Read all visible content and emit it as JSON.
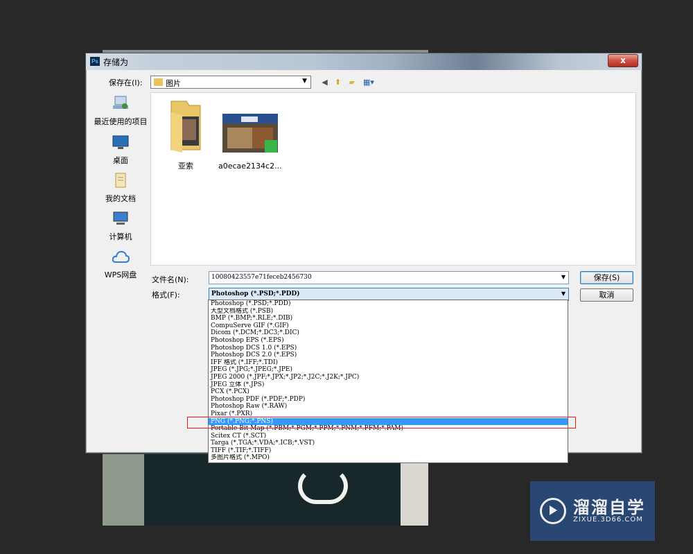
{
  "dialog": {
    "title": "存储为",
    "app_icon_label": "Ps",
    "close_label": "x",
    "look_in_label": "保存在(I):",
    "look_in_value": "图片",
    "places": [
      {
        "label": "最近使用的项目",
        "icon": "recent-items-icon"
      },
      {
        "label": "桌面",
        "icon": "desktop-icon"
      },
      {
        "label": "我的文档",
        "icon": "documents-icon"
      },
      {
        "label": "计算机",
        "icon": "computer-icon"
      },
      {
        "label": "WPS网盘",
        "icon": "cloud-icon"
      }
    ],
    "files": [
      {
        "name": "亚索",
        "type": "folder"
      },
      {
        "name": "a0ecae2134c2...",
        "type": "png-image"
      }
    ],
    "filename_label": "文件名(N):",
    "filename_value": "10080423557e71feceb2456730",
    "format_label": "格式(F):",
    "format_value": "Photoshop (*.PSD;*.PDD)",
    "save_button": "保存(S)",
    "cancel_button": "取消"
  },
  "format_options": [
    "Photoshop (*.PSD;*.PDD)",
    "大型文档格式 (*.PSB)",
    "BMP (*.BMP;*.RLE;*.DIB)",
    "CompuServe GIF (*.GIF)",
    "Dicom (*.DCM;*.DC3;*.DIC)",
    "Photoshop EPS (*.EPS)",
    "Photoshop DCS 1.0 (*.EPS)",
    "Photoshop DCS 2.0 (*.EPS)",
    "IFF 格式 (*.IFF;*.TDI)",
    "JPEG (*.JPG;*.JPEG;*.JPE)",
    "JPEG 2000 (*.JPF;*.JPX;*.JP2;*.J2C;*.J2K;*.JPC)",
    "JPEG 立体 (*.JPS)",
    "PCX (*.PCX)",
    "Photoshop PDF (*.PDF;*.PDP)",
    "Photoshop Raw (*.RAW)",
    "Pixar (*.PXR)",
    "PNG (*.PNG;*.PNS)",
    "Portable Bit Map (*.PBM;*.PGM;*.PPM;*.PNM;*.PFM;*.PAM)",
    "Scitex CT (*.SCT)",
    "Targa (*.TGA;*.VDA;*.ICB;*.VST)",
    "TIFF (*.TIF;*.TIFF)",
    "多图片格式 (*.MPO)"
  ],
  "highlighted_option_index": 16,
  "watermark": {
    "title": "溜溜自学",
    "subtitle": "ZIXUE.3D66.COM"
  },
  "colors": {
    "highlight": "#3399ff",
    "annotation_box": "#e02020",
    "watermark_bg": "#2a4a7a"
  }
}
